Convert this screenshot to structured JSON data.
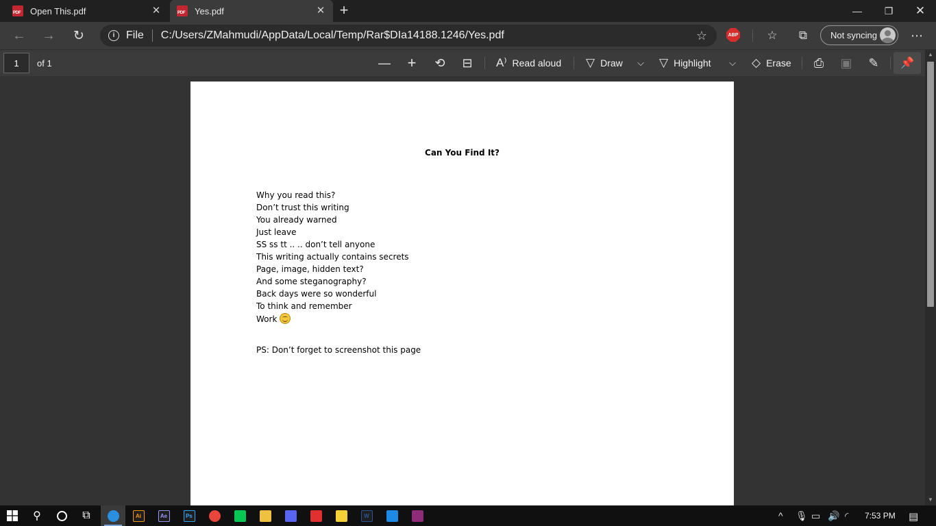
{
  "tabs": [
    {
      "label": "Open This.pdf",
      "active": false
    },
    {
      "label": "Yes.pdf",
      "active": true
    }
  ],
  "address_bar": {
    "scheme": "File",
    "url": "C:/Users/ZMahmudi/AppData/Local/Temp/Rar$DIa14188.1246/Yes.pdf",
    "abp_label": "ABP"
  },
  "profile": {
    "sync_label": "Not syncing"
  },
  "pdf_toolbar": {
    "page_number": "1",
    "page_count_label": "of 1",
    "read_aloud_label": "Read aloud",
    "draw_label": "Draw",
    "highlight_label": "Highlight",
    "erase_label": "Erase"
  },
  "document": {
    "title": "Can You Find It?",
    "lines": [
      "Why you read this?",
      "Don’t trust this writing",
      "You already warned",
      "Just leave",
      "SS ss tt .. .. don’t tell anyone",
      "This writing actually contains secrets",
      "Page, image, hidden text?",
      "And some steganography?",
      "Back days were so wonderful",
      "To think and remember",
      "Work"
    ],
    "ps": "PS: Don’t forget to screenshot this page"
  },
  "taskbar": {
    "apps": [
      {
        "name": "edge-icon",
        "label": "",
        "color": "#2b8fe0",
        "active": true
      },
      {
        "name": "illustrator-icon",
        "label": "Ai",
        "color": "#ff9a00"
      },
      {
        "name": "after-effects-icon",
        "label": "Ae",
        "color": "#9999ff"
      },
      {
        "name": "photoshop-icon",
        "label": "Ps",
        "color": "#31a8ff"
      },
      {
        "name": "chrome-icon",
        "label": "",
        "color": "#e8453c"
      },
      {
        "name": "line-icon",
        "label": "",
        "color": "#06c755"
      },
      {
        "name": "file-explorer-icon",
        "label": "",
        "color": "#f0c040"
      },
      {
        "name": "discord-icon",
        "label": "",
        "color": "#5865f2"
      },
      {
        "name": "among-us-icon",
        "label": "",
        "color": "#e03030"
      },
      {
        "name": "sticky-notes-icon",
        "label": "",
        "color": "#f7d038"
      },
      {
        "name": "word-icon",
        "label": "W",
        "color": "#2b579a"
      },
      {
        "name": "shark-icon",
        "label": "",
        "color": "#1e88e5"
      },
      {
        "name": "winrar-icon",
        "label": "",
        "color": "#8e2c7a"
      }
    ],
    "time": "7:53 PM"
  }
}
